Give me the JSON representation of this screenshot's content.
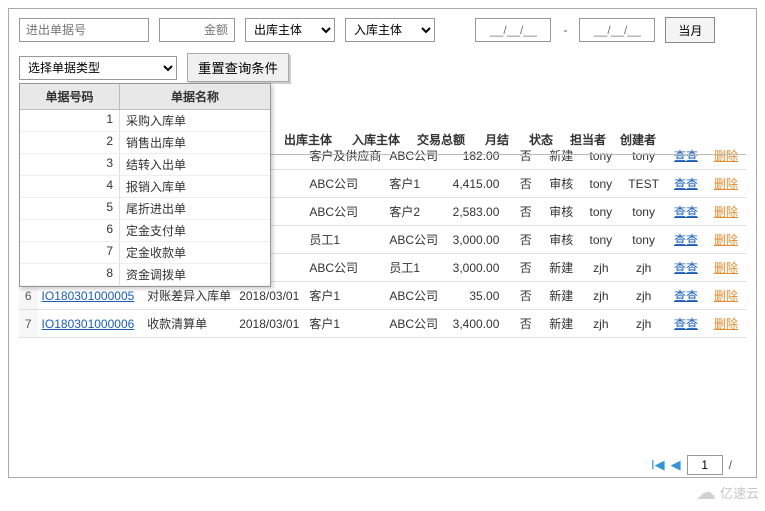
{
  "filters": {
    "doc_no_placeholder": "进出单据号",
    "amount_placeholder": "金额",
    "out_subject_placeholder": "出库主体",
    "in_subject_placeholder": "入库主体",
    "date_placeholder": "__/__/__",
    "current_month_label": "当月",
    "doc_type_placeholder": "选择单据类型",
    "reset_label": "重置查询条件"
  },
  "dropdown": {
    "col_num": "单据号码",
    "col_name": "单据名称",
    "items": [
      {
        "n": "1",
        "name": "采购入库单"
      },
      {
        "n": "2",
        "name": "销售出库单"
      },
      {
        "n": "3",
        "name": "结转入出单"
      },
      {
        "n": "4",
        "name": "报销入库单"
      },
      {
        "n": "5",
        "name": "尾折进出单"
      },
      {
        "n": "6",
        "name": "定金支付单"
      },
      {
        "n": "7",
        "name": "定金收款单"
      },
      {
        "n": "8",
        "name": "资金调拨单"
      }
    ]
  },
  "table": {
    "headers": {
      "out_subject": "出库主体",
      "in_subject": "入库主体",
      "amount": "交易总额",
      "month": "月结",
      "status": "状态",
      "owner": "担当者",
      "creator": "创建者"
    },
    "edit_label": "查查",
    "del_label": "删除",
    "rows": [
      {
        "rn": "",
        "doc": "",
        "type": "",
        "date": "",
        "out": "客户及供应商",
        "in": "ABC公司",
        "amt": "182.00",
        "mon": "否",
        "st": "新建",
        "own": "tony",
        "cr": "tony"
      },
      {
        "rn": "",
        "doc": "",
        "type": "",
        "date": "",
        "out": "ABC公司",
        "in": "客户1",
        "amt": "4,415.00",
        "mon": "否",
        "st": "审核",
        "own": "tony",
        "cr": "TEST"
      },
      {
        "rn": "",
        "doc": "",
        "type": "",
        "date": "",
        "out": "ABC公司",
        "in": "客户2",
        "amt": "2,583.00",
        "mon": "否",
        "st": "审核",
        "own": "tony",
        "cr": "tony"
      },
      {
        "rn": "",
        "doc": "",
        "type": "",
        "date": "",
        "out": "员工1",
        "in": "ABC公司",
        "amt": "3,000.00",
        "mon": "否",
        "st": "审核",
        "own": "tony",
        "cr": "tony"
      },
      {
        "rn": "",
        "doc": "",
        "type": "",
        "date": "",
        "out": "ABC公司",
        "in": "员工1",
        "amt": "3,000.00",
        "mon": "否",
        "st": "新建",
        "own": "zjh",
        "cr": "zjh"
      },
      {
        "rn": "6",
        "doc": "IO180301000005",
        "type": "对账差异入库单",
        "date": "2018/03/01",
        "out": "客户1",
        "in": "ABC公司",
        "amt": "35.00",
        "mon": "否",
        "st": "新建",
        "own": "zjh",
        "cr": "zjh"
      },
      {
        "rn": "7",
        "doc": "IO180301000006",
        "type": "收款清算单",
        "date": "2018/03/01",
        "out": "客户1",
        "in": "ABC公司",
        "amt": "3,400.00",
        "mon": "否",
        "st": "新建",
        "own": "zjh",
        "cr": "zjh"
      }
    ]
  },
  "pager": {
    "page": "1",
    "slash": "/"
  },
  "watermark": "亿速云"
}
